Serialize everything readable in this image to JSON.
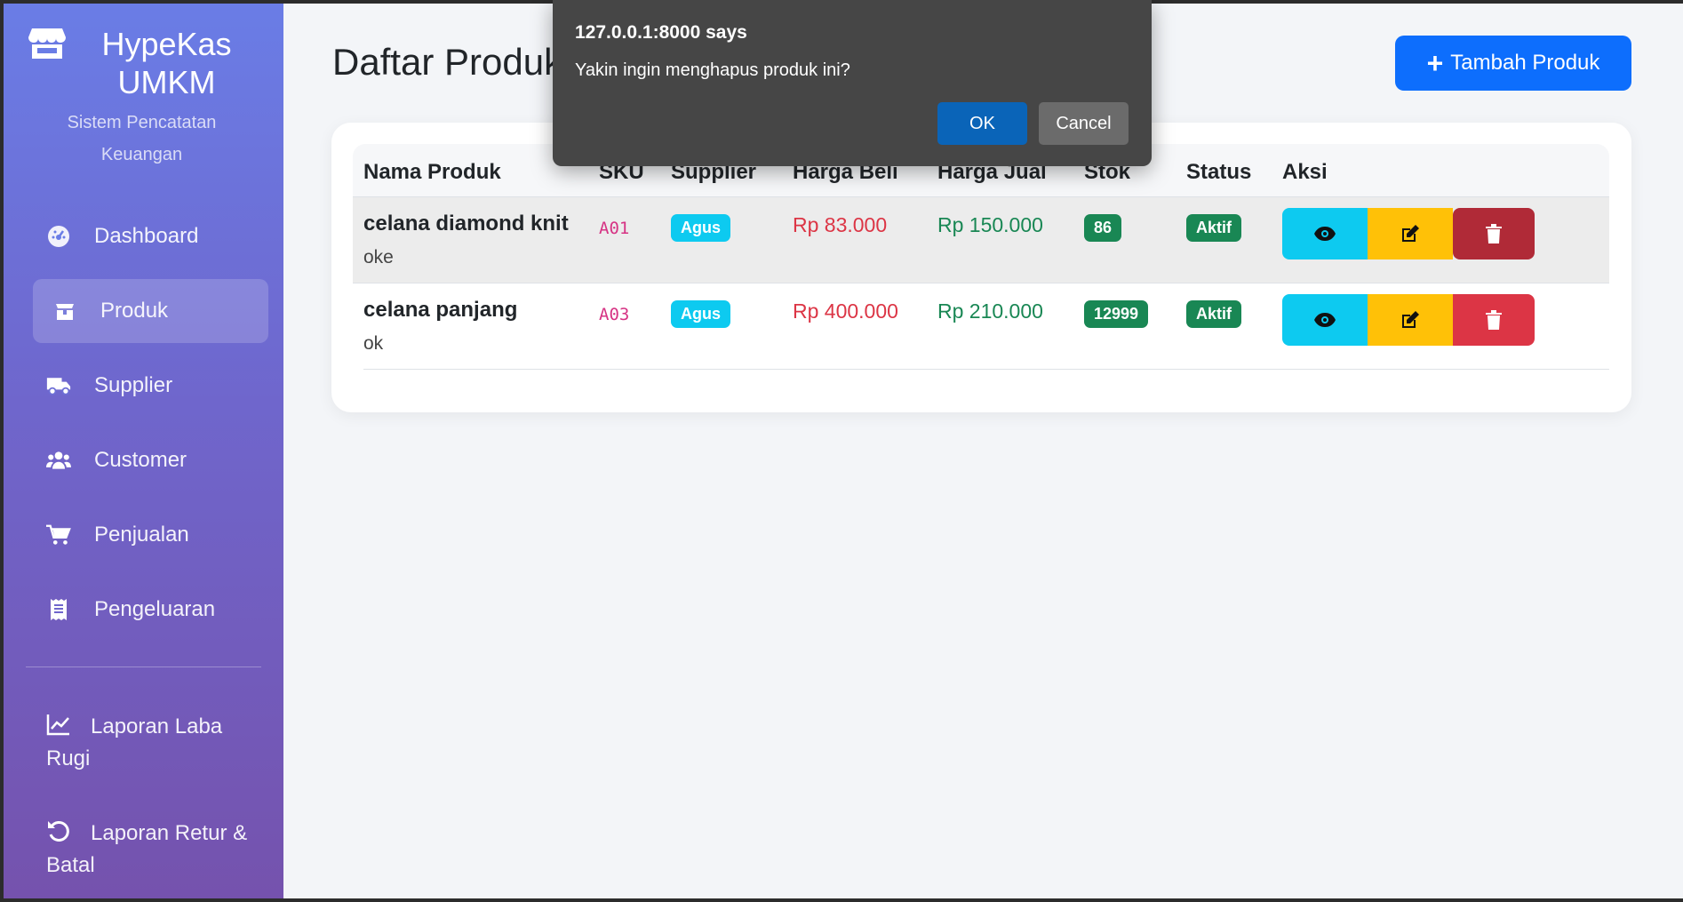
{
  "sidebar": {
    "brand_title": "HypeKas UMKM",
    "brand_subtitle": "Sistem Pencatatan Keuangan",
    "items": [
      {
        "label": "Dashboard",
        "icon": "dashboard-gauge-icon"
      },
      {
        "label": "Produk",
        "icon": "box-icon",
        "active": true
      },
      {
        "label": "Supplier",
        "icon": "truck-icon"
      },
      {
        "label": "Customer",
        "icon": "users-icon"
      },
      {
        "label": "Penjualan",
        "icon": "cart-icon"
      },
      {
        "label": "Pengeluaran",
        "icon": "receipt-icon"
      }
    ],
    "reports": [
      {
        "label": "Laporan Laba Rugi",
        "icon": "chart-line-icon"
      },
      {
        "label": "Laporan Retur & Batal",
        "icon": "undo-icon"
      }
    ]
  },
  "main": {
    "title": "Daftar Produk",
    "add_button": "Tambah Produk",
    "table": {
      "headers": [
        "Nama Produk",
        "SKU",
        "Supplier",
        "Harga Beli",
        "Harga Jual",
        "Stok",
        "Status",
        "Aksi"
      ],
      "rows": [
        {
          "name": "celana diamond knit",
          "desc": "oke",
          "sku": "A01",
          "supplier": "Agus",
          "buy": "Rp 83.000",
          "sell": "Rp 150.000",
          "stock": "86",
          "status": "Aktif"
        },
        {
          "name": "celana panjang",
          "desc": "ok",
          "sku": "A03",
          "supplier": "Agus",
          "buy": "Rp 400.000",
          "sell": "Rp 210.000",
          "stock": "12999",
          "status": "Aktif"
        }
      ]
    }
  },
  "dialog": {
    "title": "127.0.0.1:8000 says",
    "message": "Yakin ingin menghapus produk ini?",
    "ok": "OK",
    "cancel": "Cancel"
  },
  "colors": {
    "primary": "#0d6efd",
    "info": "#0dcaf0",
    "warning": "#ffc107",
    "danger": "#dc3545",
    "success": "#198754"
  }
}
